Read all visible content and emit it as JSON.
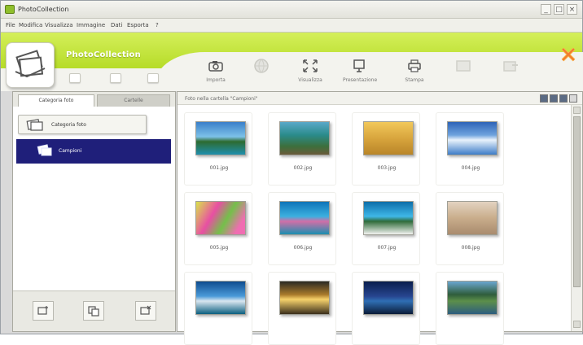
{
  "window": {
    "title": "PhotoCollection",
    "buttons": [
      "_",
      "□",
      "×"
    ]
  },
  "menu": [
    "File",
    "Modifica",
    "Visualizza",
    "Immagine",
    "Dati",
    "Esporta",
    "?"
  ],
  "header": {
    "app_name": "PhotoCollection",
    "toolbar": [
      {
        "label": "Importa",
        "icon": "camera-icon"
      },
      {
        "label": "",
        "icon": "globe-icon"
      },
      {
        "label": "Visualizza",
        "icon": "view-fit-icon"
      },
      {
        "label": "Presentazione",
        "icon": "slideshow-icon"
      },
      {
        "label": "Stampa",
        "icon": "print-icon"
      },
      {
        "label": "",
        "icon": "share-icon"
      },
      {
        "label": "",
        "icon": "export-icon"
      }
    ]
  },
  "left_panel": {
    "tabs": [
      "Categoria foto",
      "Cartelle"
    ],
    "tree_root": "Categoria foto",
    "selected_item": "Campioni",
    "bottom_buttons": [
      "new-category-icon",
      "copy-icon",
      "delete-category-icon"
    ]
  },
  "right_panel": {
    "title": "Foto nella cartella \"Campioni\"",
    "photos": [
      {
        "caption": "001.jpg"
      },
      {
        "caption": "002.jpg"
      },
      {
        "caption": "003.jpg"
      },
      {
        "caption": "004.jpg"
      },
      {
        "caption": "005.jpg"
      },
      {
        "caption": "006.jpg"
      },
      {
        "caption": "007.jpg"
      },
      {
        "caption": "008.jpg"
      },
      {
        "caption": ""
      },
      {
        "caption": ""
      },
      {
        "caption": ""
      },
      {
        "caption": ""
      }
    ]
  },
  "colors": {
    "brand_green": "#b6dc28",
    "selection_navy": "#1f1f7a"
  }
}
